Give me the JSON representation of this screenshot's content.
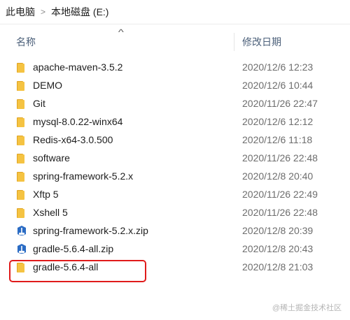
{
  "breadcrumb": {
    "items": [
      "此电脑",
      "本地磁盘 (E:)"
    ],
    "separator": ">"
  },
  "columns": {
    "name": "名称",
    "date": "修改日期",
    "sort_indicator": "^"
  },
  "files": [
    {
      "name": "apache-maven-3.5.2",
      "date": "2020/12/6 12:23",
      "type": "folder"
    },
    {
      "name": "DEMO",
      "date": "2020/12/6 10:44",
      "type": "folder"
    },
    {
      "name": "Git",
      "date": "2020/11/26 22:47",
      "type": "folder"
    },
    {
      "name": "mysql-8.0.22-winx64",
      "date": "2020/12/6 12:12",
      "type": "folder"
    },
    {
      "name": "Redis-x64-3.0.500",
      "date": "2020/12/6 11:18",
      "type": "folder"
    },
    {
      "name": "software",
      "date": "2020/11/26 22:48",
      "type": "folder"
    },
    {
      "name": "spring-framework-5.2.x",
      "date": "2020/12/8 20:40",
      "type": "folder"
    },
    {
      "name": "Xftp 5",
      "date": "2020/11/26 22:49",
      "type": "folder"
    },
    {
      "name": "Xshell 5",
      "date": "2020/11/26 22:48",
      "type": "folder"
    },
    {
      "name": "spring-framework-5.2.x.zip",
      "date": "2020/12/8 20:39",
      "type": "zip"
    },
    {
      "name": "gradle-5.6.4-all.zip",
      "date": "2020/12/8 20:43",
      "type": "zip"
    },
    {
      "name": "gradle-5.6.4-all",
      "date": "2020/12/8 21:03",
      "type": "folder",
      "highlighted": true
    }
  ],
  "watermark": "@稀土掘金技术社区",
  "colors": {
    "folder": "#f5c342",
    "folder_dark": "#e0a526",
    "zip": "#2b6cc4",
    "highlight_border": "#e01b1b",
    "header_text": "#4c607a"
  }
}
